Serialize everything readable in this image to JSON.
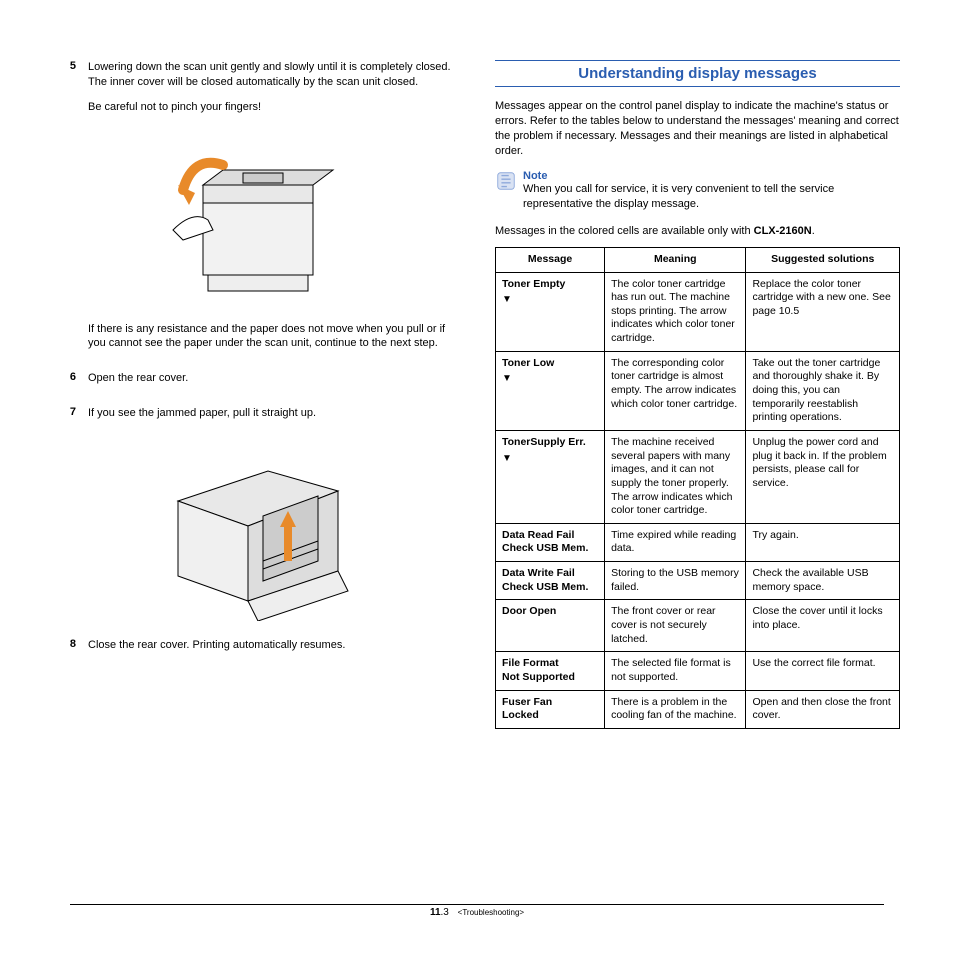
{
  "left": {
    "step5": {
      "num": "5",
      "p1": "Lowering down the scan unit gently and slowly until it is completely closed. The inner cover will be closed automatically by the scan unit closed.",
      "p2": "Be careful not to pinch your fingers!",
      "p3": "If there is any resistance and the paper does not move when you pull or if you cannot see the paper under the scan unit, continue to the next step."
    },
    "step6": {
      "num": "6",
      "p1": "Open the rear cover."
    },
    "step7": {
      "num": "7",
      "p1": "If you see the jammed paper, pull it straight up."
    },
    "step8": {
      "num": "8",
      "p1": "Close the rear cover. Printing automatically resumes."
    }
  },
  "right": {
    "title": "Understanding display messages",
    "intro": "Messages appear on the control panel display to indicate the machine's status or errors. Refer to the tables below to understand the messages' meaning and correct the problem if necessary. Messages and their meanings are listed in alphabetical order.",
    "note_label": "Note",
    "note_body": "When you call for service, it is very convenient to tell the service representative the display message.",
    "pretable_a": "Messages in the colored cells are available only with ",
    "pretable_b": "CLX-2160N",
    "pretable_c": ".",
    "headers": {
      "c1": "Message",
      "c2": "Meaning",
      "c3": "Suggested solutions"
    },
    "rows": [
      {
        "msg": "Toner Empty",
        "arrow": true,
        "meaning": "The color toner cartridge has run out. The machine stops printing. The arrow indicates which color toner cartridge.",
        "sol": "Replace the color toner cartridge with a new one. See page 10.5"
      },
      {
        "msg": "Toner Low",
        "arrow": true,
        "meaning": "The corresponding color toner cartridge is almost empty. The arrow indicates which color toner cartridge.",
        "sol": "Take out the toner cartridge and thoroughly shake it. By doing this, you can temporarily reestablish printing operations."
      },
      {
        "msg": "TonerSupply Err.",
        "arrow": true,
        "meaning": "The machine received several papers with many images, and it can not supply the toner properly. The arrow indicates which color toner cartridge.",
        "sol": "Unplug the power cord and plug it back in. If the problem persists, please call for service."
      },
      {
        "msg": "Data Read Fail\nCheck USB Mem.",
        "arrow": false,
        "meaning": "Time expired while reading data.",
        "sol": "Try again."
      },
      {
        "msg": "Data Write Fail\nCheck USB Mem.",
        "arrow": false,
        "meaning": "Storing to the USB memory failed.",
        "sol": "Check the available USB memory space."
      },
      {
        "msg": "Door Open",
        "arrow": false,
        "meaning": "The front cover or rear cover is not securely latched.",
        "sol": "Close the cover until it locks into place."
      },
      {
        "msg": "File Format\nNot Supported",
        "arrow": false,
        "meaning": "The selected file format is not supported.",
        "sol": "Use the correct file format."
      },
      {
        "msg": "Fuser Fan\nLocked",
        "arrow": false,
        "meaning": "There is a problem in the cooling fan of the machine.",
        "sol": "Open and then close the front cover."
      }
    ]
  },
  "footer": {
    "page_bold": "11",
    "page_rest": ".3",
    "chapter": "<Troubleshooting>"
  }
}
